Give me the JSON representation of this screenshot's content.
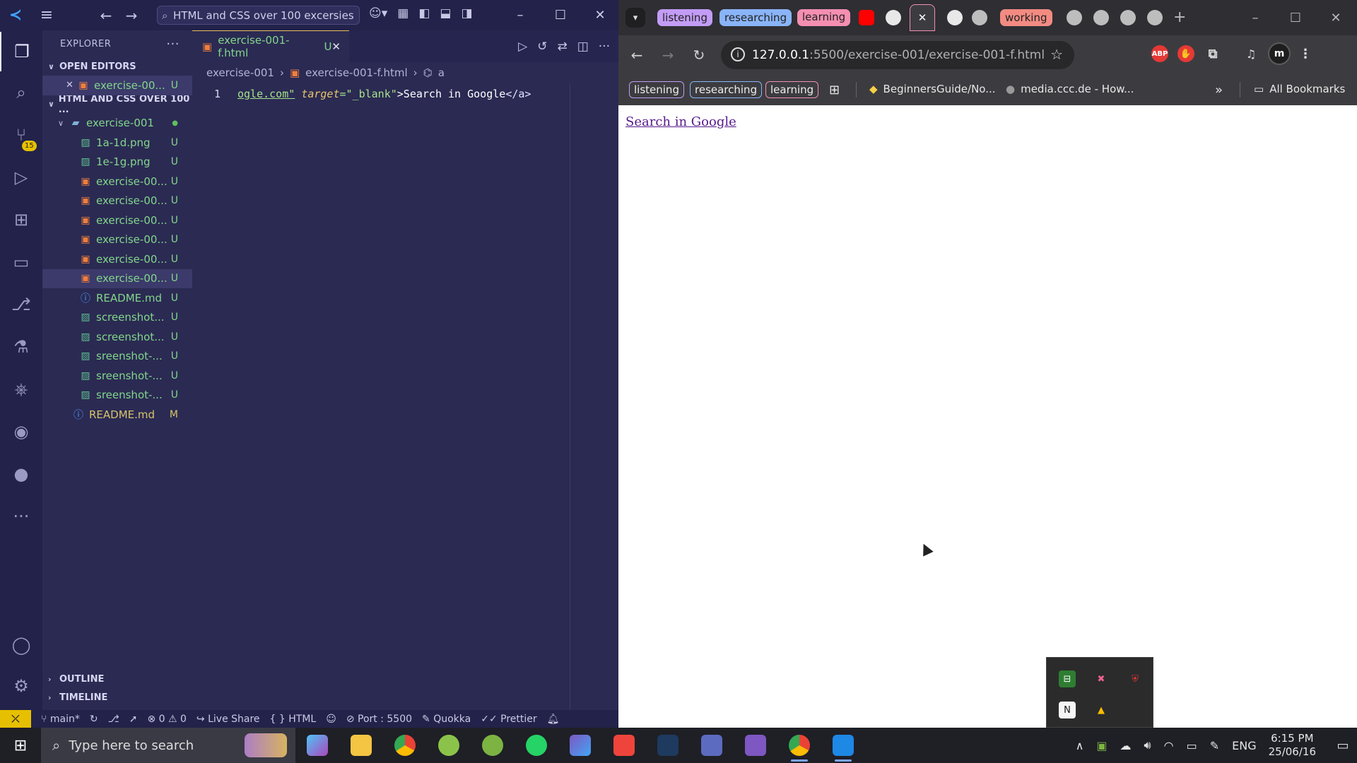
{
  "vscode": {
    "search_text": "HTML and CSS over 100 excersies",
    "explorer_title": "EXPLORER",
    "open_editors_label": "OPEN EDITORS",
    "open_editor": {
      "name": "exercise-00...",
      "status": "U"
    },
    "project_label": "HTML AND CSS OVER 100 ...",
    "folder": {
      "name": "exercise-001"
    },
    "files": [
      {
        "name": "1a-1d.png",
        "status": "U",
        "type": "img"
      },
      {
        "name": "1e-1g.png",
        "status": "U",
        "type": "img"
      },
      {
        "name": "exercise-00...",
        "status": "U",
        "type": "html"
      },
      {
        "name": "exercise-00...",
        "status": "U",
        "type": "html"
      },
      {
        "name": "exercise-00...",
        "status": "U",
        "type": "html"
      },
      {
        "name": "exercise-00...",
        "status": "U",
        "type": "html"
      },
      {
        "name": "exercise-00...",
        "status": "U",
        "type": "html"
      },
      {
        "name": "exercise-00...",
        "status": "U",
        "type": "html"
      },
      {
        "name": "README.md",
        "status": "U",
        "type": "info"
      },
      {
        "name": "screenshot...",
        "status": "U",
        "type": "img"
      },
      {
        "name": "screenshot...",
        "status": "U",
        "type": "img"
      },
      {
        "name": "sreenshot-...",
        "status": "U",
        "type": "img"
      },
      {
        "name": "sreenshot-...",
        "status": "U",
        "type": "img"
      },
      {
        "name": "sreenshot-...",
        "status": "U",
        "type": "img"
      }
    ],
    "root_readme": {
      "name": "README.md",
      "status": "M"
    },
    "outline_label": "OUTLINE",
    "timeline_label": "TIMELINE",
    "tab": {
      "name": "exercise-001-f.html",
      "status": "U"
    },
    "breadcrumb": {
      "folder": "exercise-001",
      "file": "exercise-001-f.html",
      "symbol": "a"
    },
    "code": {
      "line_number": "1",
      "part1": "ogle.com\"",
      "part2": "target",
      "part3": "=\"_blank\"",
      "part4": ">Search in Google",
      "part5": "</a>"
    },
    "badge_count": "15",
    "status": {
      "branch": "main*",
      "problems": "⊗ 0 ⚠ 0",
      "live_share": "Live Share",
      "language": "HTML",
      "port": "Port : 5500",
      "quokka": "Quokka",
      "prettier": "Prettier"
    }
  },
  "chrome": {
    "tab_groups": [
      "listening",
      "researching",
      "learning",
      "working"
    ],
    "url_host": "127.0.0.1",
    "url_path": ":5500/exercise-001/exercise-001-f.html",
    "profile_initial": "m",
    "ext_abp": "ABP",
    "bookmark_groups": [
      "listening",
      "researching",
      "learning"
    ],
    "bookmarks": [
      "BeginnersGuide/No...",
      "media.ccc.de - How..."
    ],
    "all_bookmarks": "All Bookmarks",
    "page_link": "Search in Google"
  },
  "taskbar": {
    "search_placeholder": "Type here to search",
    "language": "ENG",
    "time": "6:15 PM",
    "date": "25/06/16"
  },
  "colors": {
    "vscode_bg": "#2b2a53",
    "git_untracked": "#82d68a",
    "html_icon": "#f17e3c",
    "status_remote": "#e6c000",
    "link_visited": "#551a8b"
  }
}
